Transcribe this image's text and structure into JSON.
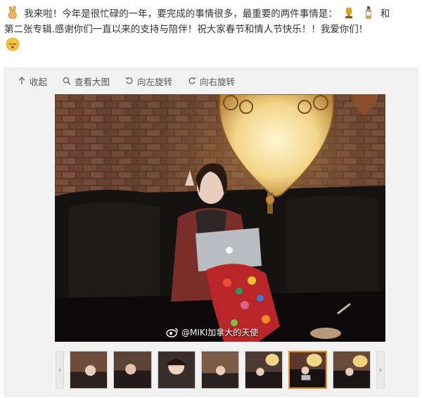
{
  "post": {
    "line1_start": "我来啦！今年是很忙碌的一年，要完成的事情很多，最重要的两件事情是：",
    "line1_end": "和",
    "line2": "第二张专辑.感谢你们一直以来的支持与陪伴！祝大家春节和情人节快乐！！我爱你们！",
    "emojis": [
      "victory-hand",
      "trophy",
      "bottle",
      "sleeping-face"
    ]
  },
  "toolbar": {
    "collapse": "收起",
    "view_large": "查看大图",
    "rotate_left": "向左旋转",
    "rotate_right": "向右旋转"
  },
  "photo": {
    "watermark": "@MIKI加拿大的天使",
    "laptop_logo": "apple-logo"
  },
  "thumbnails": {
    "count": 7,
    "active_index": 5,
    "prev_arrow": "‹",
    "next_arrow": "›"
  }
}
